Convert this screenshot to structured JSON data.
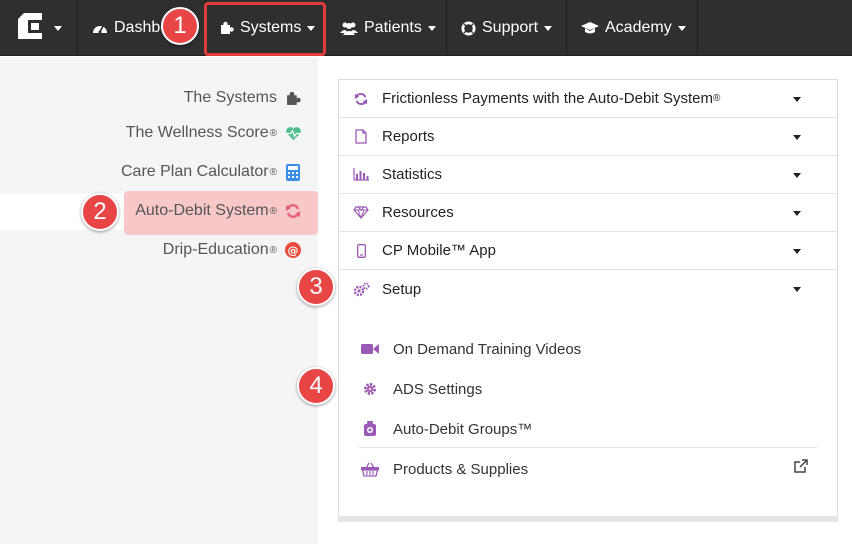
{
  "topnav": {
    "dashboard_label": "Dashboard",
    "systems_label": "Systems",
    "patients_label": "Patients",
    "support_label": "Support",
    "academy_label": "Academy"
  },
  "sidebar": {
    "items": [
      {
        "label": "The Systems",
        "mark": "",
        "icon": "puzzle-icon"
      },
      {
        "label": "The Wellness Score",
        "mark": "®",
        "icon": "heartbeat-icon"
      },
      {
        "label": "Care Plan Calculator",
        "mark": "®",
        "icon": "calculator-icon"
      },
      {
        "label": "Auto-Debit System",
        "mark": "®",
        "icon": "refresh-icon",
        "active": true
      },
      {
        "label": "Drip-Education",
        "mark": "®",
        "icon": "at-sign-icon"
      }
    ]
  },
  "accordion": {
    "sections": [
      {
        "label": "Frictionless Payments with the Auto-Debit System",
        "mark": "®",
        "icon": "refresh-icon"
      },
      {
        "label": "Reports",
        "icon": "file-icon"
      },
      {
        "label": "Statistics",
        "icon": "bar-chart-icon"
      },
      {
        "label": "Resources",
        "icon": "diamond-icon"
      },
      {
        "label": "CP Mobile™ App",
        "icon": "mobile-icon"
      },
      {
        "label": "Setup",
        "icon": "gears-icon",
        "expanded": true
      }
    ],
    "setup_items": [
      {
        "label": "On Demand Training Videos",
        "icon": "video-camera-icon"
      },
      {
        "label": "ADS Settings",
        "icon": "gear-icon"
      },
      {
        "label": "Auto-Debit Groups™",
        "icon": "groups-icon"
      },
      {
        "label": "Products & Supplies",
        "icon": "basket-icon",
        "external": true
      }
    ]
  },
  "markers": [
    "1",
    "2",
    "3",
    "4"
  ],
  "colors": {
    "nav_bg": "#2f2f2f",
    "highlight": "#f8c7c7",
    "marker": "#e84545",
    "accent_purple": "#9b59b6",
    "sidebar_bg": "#f5f5f5"
  }
}
